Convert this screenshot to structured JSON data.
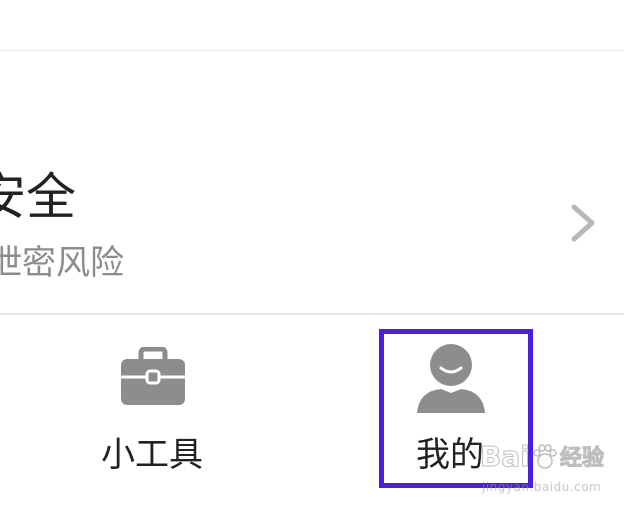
{
  "card": {
    "title": "安全",
    "subtitle": "泄密风险"
  },
  "tabs": [
    {
      "label": "小工具",
      "icon": "toolbox-icon"
    },
    {
      "label": "我的",
      "icon": "user-avatar-icon"
    }
  ],
  "highlight": {
    "color": "#4b1ee0"
  },
  "watermark": {
    "brand": "Bai",
    "suffix": "经验",
    "url": "jingyan.baidu.com"
  },
  "colors": {
    "icon_gray": "#8d8d8d",
    "text_dark": "#222222",
    "text_gray": "#8c8c8c",
    "chevron_gray": "#b8b8b8"
  }
}
